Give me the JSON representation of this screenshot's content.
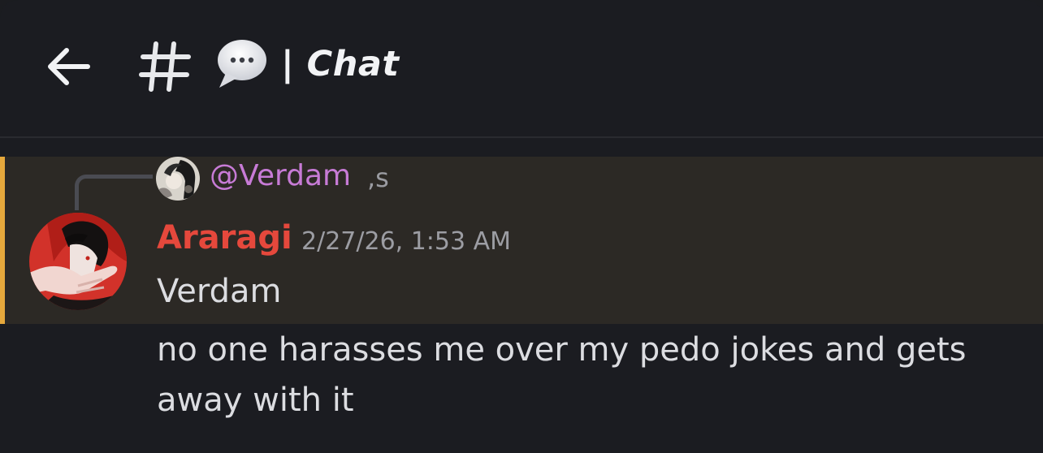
{
  "header": {
    "back_icon": "arrow-left-icon",
    "channel_type_icon": "hash-icon",
    "channel_emoji_icon": "speech-balloon-icon",
    "channel_title": "| Chat"
  },
  "message": {
    "highlight_color": "#e6a83c",
    "reply": {
      "avatar_icon": "user-avatar-icon",
      "author": "@Verdam",
      "content": ",s"
    },
    "author": {
      "avatar_icon": "user-avatar-icon",
      "name": "Araragi",
      "name_color": "#e5483c",
      "timestamp": "2/27/26, 1:53 AM"
    },
    "lines": [
      "Verdam",
      "no one harasses me over my pedo jokes and gets",
      "away with it"
    ]
  }
}
